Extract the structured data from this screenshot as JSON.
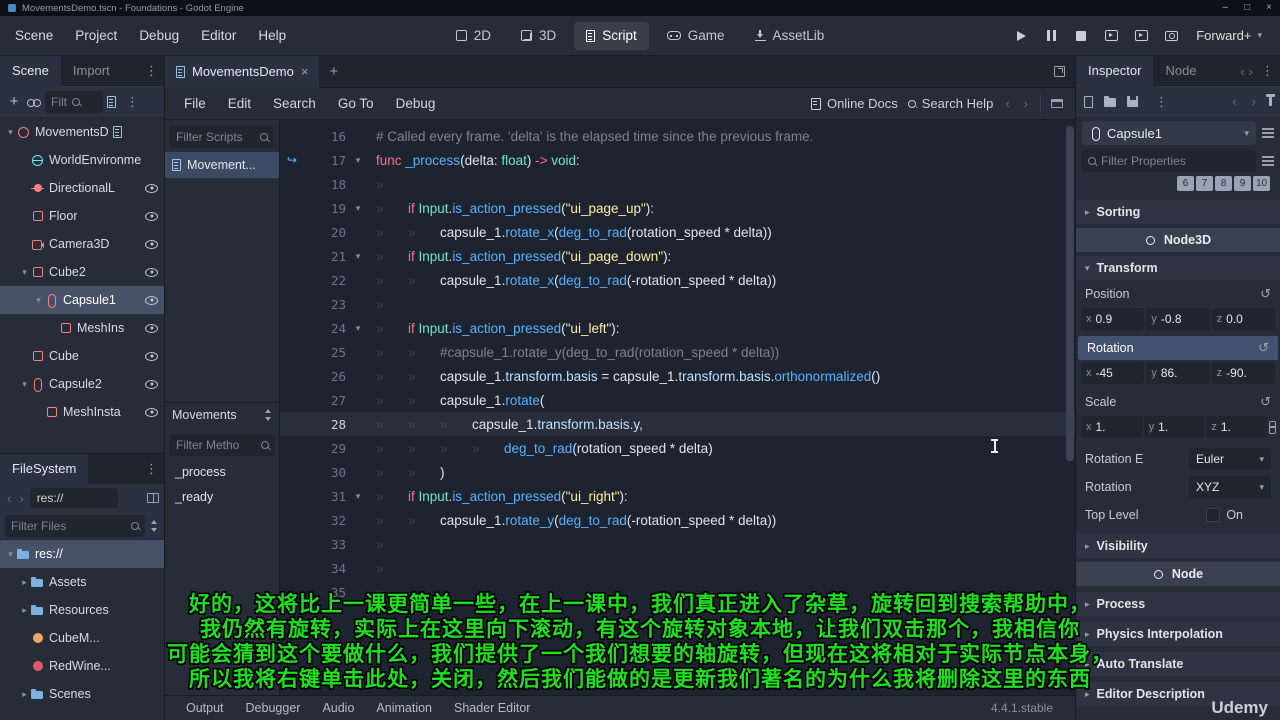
{
  "titlebar": {
    "title": "MovementsDemo.tscn - Foundations - Godot Engine"
  },
  "menubar": {
    "menus": [
      "Scene",
      "Project",
      "Debug",
      "Editor",
      "Help"
    ],
    "workspaces": [
      {
        "label": "2D",
        "icon": "2d"
      },
      {
        "label": "3D",
        "icon": "3d"
      },
      {
        "label": "Script",
        "icon": "scriptab",
        "active": true
      },
      {
        "label": "Game",
        "icon": "game"
      },
      {
        "label": "AssetLib",
        "icon": "assetlib"
      }
    ],
    "renderer": "Forward+"
  },
  "scene_panel": {
    "tabs": [
      {
        "label": "Scene",
        "active": true
      },
      {
        "label": "Import",
        "active": false
      }
    ],
    "filter_placeholder": "Filt",
    "tree": [
      {
        "label": "MovementsD",
        "depth": 0,
        "icon": "node3d",
        "expand": "open",
        "script": true
      },
      {
        "label": "WorldEnvironme",
        "depth": 1,
        "icon": "environment"
      },
      {
        "label": "DirectionalL",
        "depth": 1,
        "icon": "light",
        "eye": true
      },
      {
        "label": "Floor",
        "depth": 1,
        "icon": "mesh",
        "eye": true
      },
      {
        "label": "Camera3D",
        "depth": 1,
        "icon": "camera",
        "eye": true
      },
      {
        "label": "Cube2",
        "depth": 1,
        "icon": "mesh",
        "expand": "open",
        "eye": true
      },
      {
        "label": "Capsule1",
        "depth": 2,
        "icon": "capsule",
        "expand": "open",
        "eye": true,
        "selected": true
      },
      {
        "label": "MeshIns",
        "depth": 3,
        "icon": "mesh",
        "eye": true
      },
      {
        "label": "Cube",
        "depth": 1,
        "icon": "mesh",
        "eye": true
      },
      {
        "label": "Capsule2",
        "depth": 1,
        "icon": "capsule",
        "expand": "open",
        "eye": true
      },
      {
        "label": "MeshInsta",
        "depth": 2,
        "icon": "mesh",
        "eye": true
      }
    ]
  },
  "filesystem": {
    "title": "FileSystem",
    "path": "res://",
    "filter_placeholder": "Filter Files",
    "tree": [
      {
        "label": "res://",
        "depth": 0,
        "icon": "folder",
        "expand": "open",
        "selected": true
      },
      {
        "label": "Assets",
        "depth": 1,
        "icon": "folder",
        "expand": "closed"
      },
      {
        "label": "Resources",
        "depth": 1,
        "icon": "folder",
        "expand": "closed"
      },
      {
        "label": "CubeM...",
        "depth": 1,
        "icon": "material_orange"
      },
      {
        "label": "RedWine...",
        "depth": 1,
        "icon": "material_red"
      },
      {
        "label": "Scenes",
        "depth": 1,
        "icon": "folder",
        "expand": "closed"
      }
    ]
  },
  "script_editor": {
    "tab_label": "MovementsDemo",
    "menus": [
      "File",
      "Edit",
      "Search",
      "Go To",
      "Debug"
    ],
    "online_docs": "Online Docs",
    "search_help": "Search Help",
    "filter_scripts_placeholder": "Filter Scripts",
    "scripts": [
      {
        "label": "Movement...",
        "selected": true
      }
    ],
    "members_title": "Movements",
    "filter_methods_placeholder": "Filter Metho",
    "methods": [
      "_process",
      "_ready"
    ],
    "code": {
      "lines": [
        {
          "n": 16,
          "t": [
            [
              "c",
              "# Called every frame. 'delta' is the elapsed time since the previous frame."
            ]
          ]
        },
        {
          "n": 17,
          "fold": true,
          "mark": true,
          "t": [
            [
              "k",
              "func "
            ],
            [
              "f",
              "_process"
            ],
            [
              "p",
              "("
            ],
            [
              "p",
              "delta"
            ],
            [
              "p",
              ": "
            ],
            [
              "ty",
              "float"
            ],
            [
              "p",
              ") "
            ],
            [
              "k",
              "-> "
            ],
            [
              "ty",
              "void"
            ],
            [
              "p",
              ":"
            ]
          ]
        },
        {
          "n": 18,
          "t": [
            [
              "w",
              "»"
            ]
          ]
        },
        {
          "n": 19,
          "fold": true,
          "t": [
            [
              "w",
              "»"
            ],
            [
              "k",
              "if "
            ],
            [
              "ty",
              "Input"
            ],
            [
              "p",
              "."
            ],
            [
              "f",
              "is_action_pressed"
            ],
            [
              "p",
              "("
            ],
            [
              "s",
              "\"ui_page_up\""
            ],
            [
              "p",
              "):"
            ]
          ]
        },
        {
          "n": 20,
          "t": [
            [
              "w",
              "»"
            ],
            [
              "w",
              "»"
            ],
            [
              "p",
              "capsule_1"
            ],
            [
              "p",
              "."
            ],
            [
              "f",
              "rotate_x"
            ],
            [
              "p",
              "("
            ],
            [
              "f",
              "deg_to_rad"
            ],
            [
              "p",
              "("
            ],
            [
              "p",
              "rotation_speed "
            ],
            [
              "o",
              "* "
            ],
            [
              "p",
              "delta"
            ],
            [
              "p",
              "))"
            ]
          ]
        },
        {
          "n": 21,
          "fold": true,
          "t": [
            [
              "w",
              "»"
            ],
            [
              "k",
              "if "
            ],
            [
              "ty",
              "Input"
            ],
            [
              "p",
              "."
            ],
            [
              "f",
              "is_action_pressed"
            ],
            [
              "p",
              "("
            ],
            [
              "s",
              "\"ui_page_down\""
            ],
            [
              "p",
              "):"
            ]
          ]
        },
        {
          "n": 22,
          "t": [
            [
              "w",
              "»"
            ],
            [
              "w",
              "»"
            ],
            [
              "p",
              "capsule_1"
            ],
            [
              "p",
              "."
            ],
            [
              "f",
              "rotate_x"
            ],
            [
              "p",
              "("
            ],
            [
              "f",
              "deg_to_rad"
            ],
            [
              "p",
              "("
            ],
            [
              "o",
              "-"
            ],
            [
              "p",
              "rotation_speed "
            ],
            [
              "o",
              "* "
            ],
            [
              "p",
              "delta"
            ],
            [
              "p",
              "))"
            ]
          ]
        },
        {
          "n": 23,
          "t": [
            [
              "w",
              "»"
            ]
          ]
        },
        {
          "n": 24,
          "fold": true,
          "t": [
            [
              "w",
              "»"
            ],
            [
              "k",
              "if "
            ],
            [
              "ty",
              "Input"
            ],
            [
              "p",
              "."
            ],
            [
              "f",
              "is_action_pressed"
            ],
            [
              "p",
              "("
            ],
            [
              "s",
              "\"ui_left\""
            ],
            [
              "p",
              "):"
            ]
          ]
        },
        {
          "n": 25,
          "t": [
            [
              "w",
              "»"
            ],
            [
              "w",
              "»"
            ],
            [
              "c",
              "#capsule_1.rotate_y(deg_to_rad(rotation_speed * delta))"
            ]
          ]
        },
        {
          "n": 26,
          "t": [
            [
              "w",
              "»"
            ],
            [
              "w",
              "»"
            ],
            [
              "p",
              "capsule_1"
            ],
            [
              "p",
              "."
            ],
            [
              "m",
              "transform"
            ],
            [
              "p",
              "."
            ],
            [
              "m",
              "basis"
            ],
            [
              "o",
              " = "
            ],
            [
              "p",
              "capsule_1"
            ],
            [
              "p",
              "."
            ],
            [
              "m",
              "transform"
            ],
            [
              "p",
              "."
            ],
            [
              "m",
              "basis"
            ],
            [
              "p",
              "."
            ],
            [
              "f",
              "orthonormalized"
            ],
            [
              "p",
              "()"
            ]
          ]
        },
        {
          "n": 27,
          "t": [
            [
              "w",
              "»"
            ],
            [
              "w",
              "»"
            ],
            [
              "p",
              "capsule_1"
            ],
            [
              "p",
              "."
            ],
            [
              "f",
              "rotate"
            ],
            [
              "p",
              "("
            ]
          ]
        },
        {
          "n": 28,
          "cur": true,
          "t": [
            [
              "w",
              "»"
            ],
            [
              "w",
              "»"
            ],
            [
              "w",
              "»"
            ],
            [
              "p",
              "capsule_1"
            ],
            [
              "p",
              "."
            ],
            [
              "m",
              "transform"
            ],
            [
              "p",
              "."
            ],
            [
              "m",
              "basis"
            ],
            [
              "p",
              "."
            ],
            [
              "m",
              "y"
            ],
            [
              "p",
              ","
            ]
          ]
        },
        {
          "n": 29,
          "t": [
            [
              "w",
              "»"
            ],
            [
              "w",
              "»"
            ],
            [
              "w",
              "»"
            ],
            [
              "w",
              "»"
            ],
            [
              "f",
              "deg_to_rad"
            ],
            [
              "p",
              "("
            ],
            [
              "p",
              "rotation_speed "
            ],
            [
              "o",
              "* "
            ],
            [
              "p",
              "delta"
            ],
            [
              "p",
              ")"
            ]
          ]
        },
        {
          "n": 30,
          "t": [
            [
              "w",
              "»"
            ],
            [
              "w",
              "»"
            ],
            [
              "p",
              ")"
            ]
          ]
        },
        {
          "n": 31,
          "fold": true,
          "t": [
            [
              "w",
              "»"
            ],
            [
              "k",
              "if "
            ],
            [
              "ty",
              "Input"
            ],
            [
              "p",
              "."
            ],
            [
              "f",
              "is_action_pressed"
            ],
            [
              "p",
              "("
            ],
            [
              "s",
              "\"ui_right\""
            ],
            [
              "p",
              "):"
            ]
          ]
        },
        {
          "n": 32,
          "t": [
            [
              "w",
              "»"
            ],
            [
              "w",
              "»"
            ],
            [
              "p",
              "capsule_1"
            ],
            [
              "p",
              "."
            ],
            [
              "f",
              "rotate_y"
            ],
            [
              "p",
              "("
            ],
            [
              "f",
              "deg_to_rad"
            ],
            [
              "p",
              "("
            ],
            [
              "o",
              "-"
            ],
            [
              "p",
              "rotation_speed "
            ],
            [
              "o",
              "* "
            ],
            [
              "p",
              "delta"
            ],
            [
              "p",
              "))"
            ]
          ]
        },
        {
          "n": 33,
          "t": [
            [
              "w",
              "»"
            ]
          ]
        },
        {
          "n": 34,
          "t": [
            [
              "w",
              "»"
            ]
          ]
        },
        {
          "n": 35,
          "t": [
            [
              "w",
              "»"
            ]
          ]
        }
      ]
    }
  },
  "bottom_bar": {
    "tabs": [
      "Output",
      "Debugger",
      "Audio",
      "Animation",
      "Shader Editor"
    ],
    "version": "4.4.1.stable"
  },
  "inspector": {
    "tabs": [
      {
        "label": "Inspector",
        "active": true
      },
      {
        "label": "Node",
        "active": false
      }
    ],
    "object_name": "Capsule1",
    "filter_placeholder": "Filter Properties",
    "layer_numbers": [
      "6",
      "7",
      "8",
      "9",
      "10"
    ],
    "axes": [
      "x",
      "y",
      "z"
    ],
    "sections": {
      "sorting": "Sorting",
      "transform": "Transform",
      "visibility": "Visibility"
    },
    "categories": {
      "node3d": "Node3D",
      "node": "Node"
    },
    "transform": {
      "position": {
        "label": "Position",
        "x": "0.9",
        "y": "-0.8",
        "z": "0.0"
      },
      "rotation": {
        "label": "Rotation",
        "x": "-45",
        "y": "86.",
        "z": "-90."
      },
      "scale": {
        "label": "Scale",
        "x": "1.",
        "y": "1.",
        "z": "1."
      },
      "rotation_edit": {
        "label": "Rotation E",
        "value": "Euler"
      },
      "rotation_order": {
        "label": "Rotation",
        "value": "XYZ"
      },
      "top_level": {
        "label": "Top Level",
        "value": "On"
      }
    },
    "node_sections": [
      "Process",
      "Physics Interpolation",
      "Auto Translate",
      "Editor Description"
    ]
  },
  "subtitles": [
    "好的，这将比上一课更简单一些，在上一课中，我们真正进入了杂草，旋转回到搜索帮助中，",
    "我仍然有旋转，实际上在这里向下滚动，有这个旋转对象本地，让我们双击那个，我相信你",
    "可能会猜到这个要做什么，我们提供了一个我们想要的轴旋转，但现在这将相对于实际节点本身，",
    "所以我将右键单击此处，关闭，然后我们能做的是更新我们著名的为什么我将删除这里的东西"
  ],
  "watermark": "Udemy"
}
